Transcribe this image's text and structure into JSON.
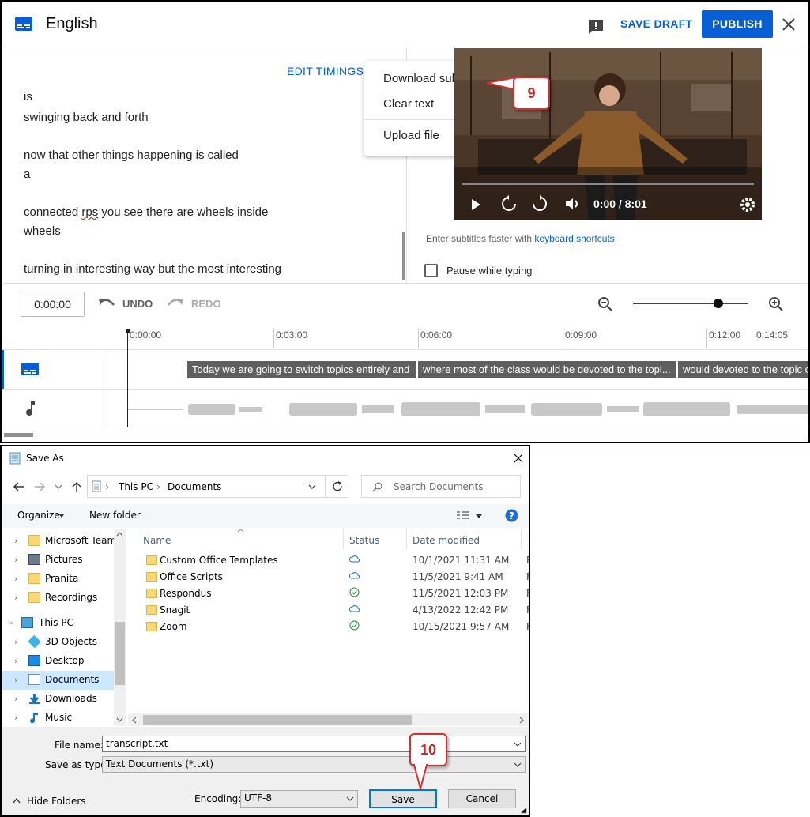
{
  "editor": {
    "title": "English",
    "save_draft": "SAVE DRAFT",
    "publish": "PUBLISH",
    "edit_timings": "EDIT TIMINGS",
    "subtitle_lines": [
      "is",
      "swinging back and forth",
      "now that other things happening is called",
      "a",
      "connected rps you see there are wheels inside",
      "wheels",
      "turning in interesting way but the most interesting"
    ],
    "menu": [
      "Download subtitles",
      "Clear text",
      "Upload file"
    ],
    "video_time": "0:00 / 8:01",
    "shortcut_text": "Enter subtitles faster with",
    "shortcut_link": "keyboard shortcuts",
    "shortcut_end": ".",
    "pause_label": "Pause while typing",
    "time_input": "0:00:00",
    "undo": "UNDO",
    "redo": "REDO",
    "timeline_labels": [
      "0:00:00",
      "0:03:00",
      "0:06:00",
      "0:09:00",
      "0:12:00",
      "0:14:05"
    ],
    "cues": [
      "Today we are going to switch topics entirely and",
      "where most of the class would be devoted to the topi...",
      "would devoted to the topic o"
    ]
  },
  "callouts": {
    "first": "9",
    "second": "10"
  },
  "dialog": {
    "title": "Save As",
    "path": [
      "This PC",
      "Documents"
    ],
    "search_placeholder": "Search Documents",
    "organize": "Organize",
    "new_folder": "New folder",
    "tree": [
      {
        "label": "Microsoft Teams",
        "icon": "folder-icon",
        "selected": false
      },
      {
        "label": "Pictures",
        "icon": "pictures-icon",
        "selected": false
      },
      {
        "label": "Pranita",
        "icon": "user-folder-icon",
        "selected": false
      },
      {
        "label": "Recordings",
        "icon": "folder-icon",
        "selected": false
      },
      {
        "label": "This PC",
        "icon": "computer-icon",
        "selected": false
      },
      {
        "label": "3D Objects",
        "icon": "3d-objects-icon",
        "selected": false
      },
      {
        "label": "Desktop",
        "icon": "desktop-icon",
        "selected": false
      },
      {
        "label": "Documents",
        "icon": "documents-icon",
        "selected": true
      },
      {
        "label": "Downloads",
        "icon": "downloads-icon",
        "selected": false
      },
      {
        "label": "Music",
        "icon": "music-icon",
        "selected": false
      }
    ],
    "columns": [
      "Name",
      "Status",
      "Date modified",
      "T"
    ],
    "files": [
      {
        "name": "Custom Office Templates",
        "status": "cloud",
        "date": "10/1/2021 11:31 AM",
        "type": "F"
      },
      {
        "name": "Office Scripts",
        "status": "cloud",
        "date": "11/5/2021 9:41 AM",
        "type": "F"
      },
      {
        "name": "Respondus",
        "status": "synced",
        "date": "11/5/2021 12:03 PM",
        "type": "F"
      },
      {
        "name": "Snagit",
        "status": "cloud",
        "date": "4/13/2022 12:42 PM",
        "type": "F"
      },
      {
        "name": "Zoom",
        "status": "synced",
        "date": "10/15/2021 9:57 AM",
        "type": "F"
      }
    ],
    "file_name_label": "File name:",
    "file_name": "transcript.txt",
    "save_type_label": "Save as type:",
    "save_type": "Text Documents (*.txt)",
    "hide_folders": "Hide Folders",
    "encoding_label": "Encoding:",
    "encoding": "UTF-8",
    "save": "Save",
    "cancel": "Cancel"
  },
  "colors": {
    "accent": "#065fd4",
    "callout": "#d32f2f",
    "selection": "#cce8ff"
  }
}
